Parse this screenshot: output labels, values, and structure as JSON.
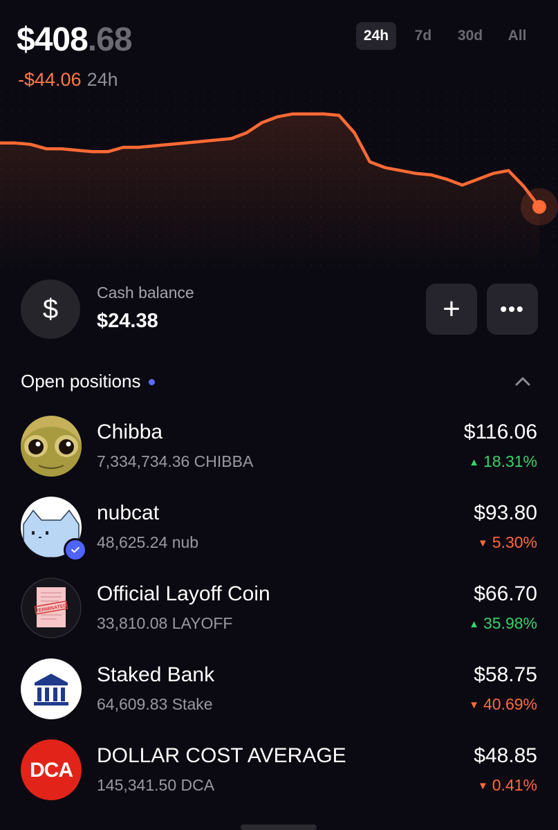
{
  "portfolio": {
    "balance_main": "$408",
    "balance_cents": ".68",
    "change_amount": "-$44.06",
    "change_period": "24h"
  },
  "range_tabs": [
    {
      "label": "24h",
      "active": true
    },
    {
      "label": "7d",
      "active": false
    },
    {
      "label": "30d",
      "active": false
    },
    {
      "label": "All",
      "active": false
    }
  ],
  "chart_data": {
    "type": "line",
    "values": [
      0.27,
      0.27,
      0.28,
      0.31,
      0.31,
      0.32,
      0.33,
      0.33,
      0.3,
      0.3,
      0.29,
      0.28,
      0.27,
      0.26,
      0.25,
      0.24,
      0.2,
      0.13,
      0.09,
      0.07,
      0.07,
      0.07,
      0.08,
      0.2,
      0.4,
      0.44,
      0.46,
      0.48,
      0.49,
      0.52,
      0.56,
      0.52,
      0.48,
      0.46,
      0.57,
      0.71
    ],
    "color": "#ff6a35"
  },
  "cash": {
    "icon": "dollar-icon",
    "symbol": "$",
    "label": "Cash balance",
    "value": "$24.38",
    "add_symbol": "+",
    "more_symbol": "•••"
  },
  "open_positions": {
    "title": "Open positions",
    "items": [
      {
        "name": "Chibba",
        "amount": "7,334,734.36 CHIBBA",
        "value": "$116.06",
        "change": "18.31%",
        "direction": "up",
        "arrow": "▲"
      },
      {
        "name": "nubcat",
        "amount": "48,625.24 nub",
        "value": "$93.80",
        "change": "5.30%",
        "direction": "down",
        "arrow": "▼"
      },
      {
        "name": "Official Layoff Coin",
        "amount": "33,810.08 LAYOFF",
        "value": "$66.70",
        "change": "35.98%",
        "direction": "up",
        "arrow": "▲"
      },
      {
        "name": "Staked Bank",
        "amount": "64,609.83 Stake",
        "value": "$58.75",
        "change": "40.69%",
        "direction": "down",
        "arrow": "▼"
      },
      {
        "name": "DOLLAR COST AVERAGE",
        "amount": "145,341.50 DCA",
        "value": "$48.85",
        "change": "0.41%",
        "direction": "down",
        "arrow": "▼"
      }
    ]
  },
  "token_labels": {
    "layoff_stamp": "TERMINATED",
    "dca_logo": "DCA"
  },
  "colors": {
    "background": "#0b0a12",
    "accent": "#ff6a35",
    "positive": "#39d26b",
    "negative": "#ff6a3d",
    "dot": "#5b6cff"
  }
}
